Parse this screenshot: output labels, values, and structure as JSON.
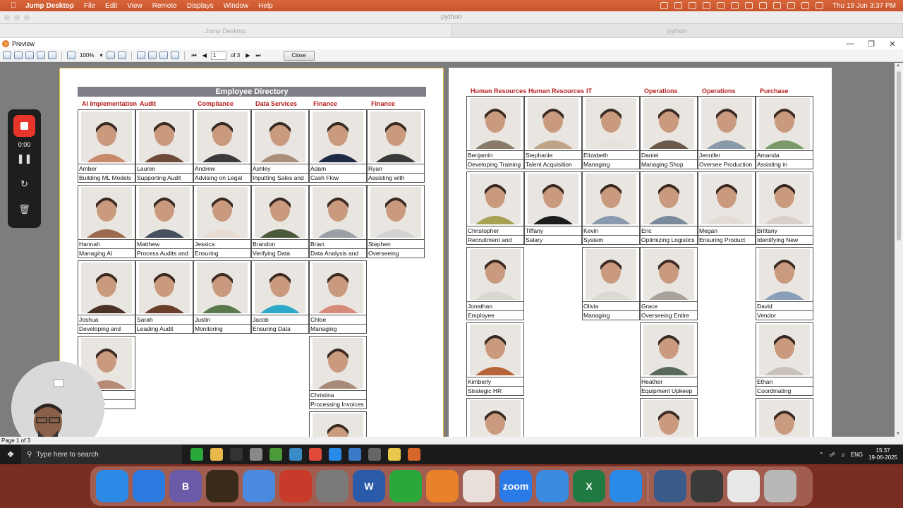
{
  "menubar": {
    "app_name": "Jump Desktop",
    "menus": [
      "File",
      "Edit",
      "View",
      "Remote",
      "Displays",
      "Window",
      "Help"
    ],
    "clock": "Thu 19 Jun  3:37 PM"
  },
  "jump_window": {
    "title": "python",
    "tabs": [
      "Jump Desktop",
      "python"
    ]
  },
  "preview": {
    "title": "Preview",
    "zoom": "100%",
    "page_input": "1",
    "page_of": "of 3",
    "close_label": "Close",
    "status": "Page 1 of 3"
  },
  "recorder": {
    "time": "0:00"
  },
  "taskbar": {
    "search_placeholder": "Type here to search",
    "lang": "ENG",
    "time": "15:37",
    "date": "19-06-2025"
  },
  "page1": {
    "title": "Employee Directory",
    "columns": [
      {
        "dept": "AI Implementation",
        "cards": [
          {
            "name": "Amber",
            "role": "Building ML Models",
            "color": "#c88a6a"
          },
          {
            "name": "Hannah",
            "role": "Managing AI",
            "color": "#9c6a4e"
          },
          {
            "name": "Joshua",
            "role": "Developing and",
            "color": "#4a3226"
          },
          {
            "name": "",
            "role": "g Data for",
            "color": "#b88a78"
          }
        ]
      },
      {
        "dept": "Audit",
        "cards": [
          {
            "name": "Lauren",
            "role": "Supporting Audit",
            "color": "#6e4a3a"
          },
          {
            "name": "Matthew",
            "role": "Process Audits and",
            "color": "#47505e"
          },
          {
            "name": "Sarah",
            "role": "Leading Audit",
            "color": "#6a3f2c"
          }
        ]
      },
      {
        "dept": "Compliance",
        "cards": [
          {
            "name": "Andrew",
            "role": "Advising on Legal",
            "color": "#3c3a3a"
          },
          {
            "name": "Jessica",
            "role": "Ensuring",
            "color": "#e8dcd2"
          },
          {
            "name": "Justin",
            "role": "Monitoring",
            "color": "#5a7a4e"
          }
        ]
      },
      {
        "dept": "Data Services",
        "cards": [
          {
            "name": "Ashley",
            "role": "Inputting Sales and",
            "color": "#a8907a"
          },
          {
            "name": "Brandon",
            "role": "Verifying Data",
            "color": "#4a5a3a"
          },
          {
            "name": "Jacob",
            "role": "Ensuring Data",
            "color": "#2ea8c8"
          }
        ]
      },
      {
        "dept": "Finance",
        "cards": [
          {
            "name": "Adam",
            "role": "Cash Flow",
            "color": "#1f2a44"
          },
          {
            "name": "Brian",
            "role": "Data Analysis and",
            "color": "#9aa0a6"
          },
          {
            "name": "Chloe",
            "role": "Managing",
            "color": "#d88a7a"
          },
          {
            "name": "Christina",
            "role": "Processing Invoices",
            "color": "#a88a78"
          },
          {
            "name": "",
            "role": "",
            "color": "#c8c2ba"
          }
        ]
      },
      {
        "dept": "Finance",
        "cards": [
          {
            "name": "Ryan",
            "role": "Assisting with",
            "color": "#3a3a3a"
          },
          {
            "name": "Stephen",
            "role": "Overseeing",
            "color": "#d4d4d4"
          }
        ]
      }
    ]
  },
  "page2": {
    "columns": [
      {
        "dept": "Human Resources",
        "cards": [
          {
            "name": "Benjamin",
            "role": "Developing Training",
            "color": "#8a7a6a"
          },
          {
            "name": "Christopher",
            "role": "Recruitment and",
            "color": "#a8a052"
          },
          {
            "name": "Jonathan",
            "role": "Employee",
            "color": "#dad6d2"
          },
          {
            "name": "Kimberly",
            "role": "Strategic HR",
            "color": "#b8643a"
          },
          {
            "name": "",
            "role": "",
            "color": "#c8b8a8"
          }
        ]
      },
      {
        "dept": "Human Resources",
        "cards": [
          {
            "name": "Stephanie",
            "role": "Talent Acquisition",
            "color": "#c0a488"
          },
          {
            "name": "Tiffany",
            "role": "Salary",
            "color": "#1c1c1c"
          }
        ]
      },
      {
        "dept": "IT",
        "cards": [
          {
            "name": "Elizabeth",
            "role": "Managing",
            "color": "#e6e2de"
          },
          {
            "name": "Kevin",
            "role": "System",
            "color": "#8a9aae"
          },
          {
            "name": "Olivia",
            "role": "Managing",
            "color": "#dcd8d4"
          }
        ]
      },
      {
        "dept": "Operations",
        "cards": [
          {
            "name": "Daniel",
            "role": "Managing Shop",
            "color": "#6a5a4e"
          },
          {
            "name": "Eric",
            "role": "Optimizing Logistics",
            "color": "#7a8a9a"
          },
          {
            "name": "Grace",
            "role": "Overseeing Entire",
            "color": "#a8a29c"
          },
          {
            "name": "Heather",
            "role": "Equipment Upkeep",
            "color": "#5a6a5a"
          },
          {
            "name": "",
            "role": "",
            "color": "#b8aa9a"
          }
        ]
      },
      {
        "dept": "Operations",
        "cards": [
          {
            "name": "Jennifer",
            "role": "Oversee Production",
            "color": "#8a9aa8"
          },
          {
            "name": "Megan",
            "role": "Ensuring Product",
            "color": "#e2dcd4"
          }
        ]
      },
      {
        "dept": "Purchase",
        "cards": [
          {
            "name": "Amanda",
            "role": "Assisting in",
            "color": "#7a9a6a"
          },
          {
            "name": "Brittany",
            "role": "Identifying New",
            "color": "#d8d0c8"
          },
          {
            "name": "David",
            "role": "Vendor",
            "color": "#8aa0b8"
          },
          {
            "name": "Ethan",
            "role": "Coordinating",
            "color": "#c8c2b8"
          },
          {
            "name": "",
            "role": "",
            "color": "#a89a7a"
          }
        ]
      }
    ]
  },
  "dock_apps": [
    {
      "icon": "finder-icon",
      "color": "#2a8ae6"
    },
    {
      "icon": "safari-icon",
      "color": "#2a7ae0"
    },
    {
      "icon": "bbedit-icon",
      "color": "#6a5aa8",
      "glyph": "B"
    },
    {
      "icon": "broom-icon",
      "color": "#3a2a1a"
    },
    {
      "icon": "bookmark-icon",
      "color": "#4a8ae0"
    },
    {
      "icon": "toolbox-icon",
      "color": "#c83a2a"
    },
    {
      "icon": "system-settings-icon",
      "color": "#7a7a7a"
    },
    {
      "icon": "word-icon",
      "color": "#2a5aa8",
      "glyph": "W"
    },
    {
      "icon": "green-arrows-icon",
      "color": "#2aa83a"
    },
    {
      "icon": "books-icon",
      "color": "#e8822a"
    },
    {
      "icon": "red-m-icon",
      "color": "#e8e0d8"
    },
    {
      "icon": "zoom-icon",
      "color": "#2a7ae8",
      "glyph": "zoom"
    },
    {
      "icon": "keynote-icon",
      "color": "#3a8ae0"
    },
    {
      "icon": "excel-icon",
      "color": "#1e7a40",
      "glyph": "X"
    },
    {
      "icon": "airline-icon",
      "color": "#2a8ae8"
    },
    {
      "icon": "password-icon",
      "color": "#3a5a8a"
    },
    {
      "icon": "printer-icon",
      "color": "#3a3a3a"
    },
    {
      "icon": "preview-doc-icon",
      "color": "#e8e8e8"
    },
    {
      "icon": "trash-icon",
      "color": "#b8b8b8"
    }
  ]
}
